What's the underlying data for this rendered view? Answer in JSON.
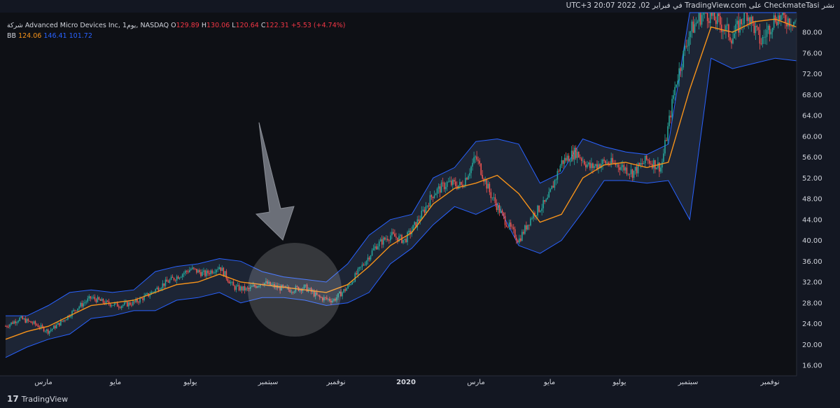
{
  "header": {
    "text": "نشر CheckmateTasi على TradingView.com في فبراير 02, 2022 20:07 UTC+3"
  },
  "legend": {
    "symbol": "شركة Advanced Micro Devices Inc, يوم1, NASDAQ",
    "o_label": "O",
    "o": "129.89",
    "h_label": "H",
    "h": "130.06",
    "l_label": "L",
    "l": "120.64",
    "c_label": "C",
    "c": "122.31",
    "change": "+5.53 (+4.74%)",
    "bb_label": "BB",
    "bb_mid": "124.06",
    "bb_up": "146.41",
    "bb_low": "101.72"
  },
  "footer": {
    "brand": "TradingView"
  },
  "chart_data": {
    "type": "candlestick",
    "y_axis_ticks": [
      "16.00",
      "20.00",
      "24.00",
      "28.00",
      "32.00",
      "36.00",
      "40.00",
      "44.00",
      "48.00",
      "52.00",
      "56.00",
      "60.00",
      "64.00",
      "68.00",
      "72.00",
      "76.00",
      "80.00"
    ],
    "ylim": [
      16,
      84
    ],
    "x_axis_ticks": [
      "مارس",
      "مايو",
      "يوليو",
      "سبتمبر",
      "نوفمبر",
      "2020",
      "مارس",
      "مايو",
      "يوليو",
      "سبتمبر",
      "نوفمبر"
    ],
    "series": [
      {
        "name": "BB",
        "points": [
          {
            "x": 0,
            "mid": 21.0,
            "up": 25.5,
            "low": 17.5
          },
          {
            "x": 3,
            "mid": 22.5,
            "up": 25.5,
            "low": 19.5
          },
          {
            "x": 6,
            "mid": 23.5,
            "up": 27.5,
            "low": 21.0
          },
          {
            "x": 9,
            "mid": 25.5,
            "up": 30.0,
            "low": 22.0
          },
          {
            "x": 12,
            "mid": 27.5,
            "up": 30.5,
            "low": 25.0
          },
          {
            "x": 15,
            "mid": 28.0,
            "up": 30.0,
            "low": 25.5
          },
          {
            "x": 18,
            "mid": 28.5,
            "up": 30.5,
            "low": 26.5
          },
          {
            "x": 21,
            "mid": 30.0,
            "up": 34.0,
            "low": 26.5
          },
          {
            "x": 24,
            "mid": 31.5,
            "up": 35.0,
            "low": 28.5
          },
          {
            "x": 27,
            "mid": 32.0,
            "up": 35.5,
            "low": 29.0
          },
          {
            "x": 30,
            "mid": 33.5,
            "up": 36.5,
            "low": 30.0
          },
          {
            "x": 33,
            "mid": 32.0,
            "up": 36.0,
            "low": 28.0
          },
          {
            "x": 36,
            "mid": 31.5,
            "up": 34.0,
            "low": 29.0
          },
          {
            "x": 39,
            "mid": 31.0,
            "up": 33.0,
            "low": 29.0
          },
          {
            "x": 42,
            "mid": 30.5,
            "up": 32.5,
            "low": 28.5
          },
          {
            "x": 45,
            "mid": 30.0,
            "up": 32.0,
            "low": 27.5
          },
          {
            "x": 48,
            "mid": 31.5,
            "up": 35.5,
            "low": 28.0
          },
          {
            "x": 51,
            "mid": 35.0,
            "up": 41.0,
            "low": 30.0
          },
          {
            "x": 54,
            "mid": 39.0,
            "up": 44.0,
            "low": 35.5
          },
          {
            "x": 57,
            "mid": 41.5,
            "up": 45.0,
            "low": 38.5
          },
          {
            "x": 60,
            "mid": 47.0,
            "up": 52.0,
            "low": 43.0
          },
          {
            "x": 63,
            "mid": 50.0,
            "up": 54.0,
            "low": 46.5
          },
          {
            "x": 66,
            "mid": 51.0,
            "up": 59.0,
            "low": 45.0
          },
          {
            "x": 69,
            "mid": 52.5,
            "up": 59.5,
            "low": 47.0
          },
          {
            "x": 72,
            "mid": 49.0,
            "up": 58.5,
            "low": 39.0
          },
          {
            "x": 75,
            "mid": 43.5,
            "up": 51.0,
            "low": 37.5
          },
          {
            "x": 78,
            "mid": 45.0,
            "up": 53.0,
            "low": 40.0
          },
          {
            "x": 81,
            "mid": 52.0,
            "up": 59.5,
            "low": 45.5
          },
          {
            "x": 84,
            "mid": 54.5,
            "up": 58.0,
            "low": 51.5
          },
          {
            "x": 87,
            "mid": 55.0,
            "up": 57.0,
            "low": 51.5
          },
          {
            "x": 90,
            "mid": 54.0,
            "up": 56.5,
            "low": 51.0
          },
          {
            "x": 93,
            "mid": 55.0,
            "up": 58.5,
            "low": 51.5
          },
          {
            "x": 96,
            "mid": 69.0,
            "up": 84.0,
            "low": 44.0
          },
          {
            "x": 99,
            "mid": 81.0,
            "up": 86.0,
            "low": 75.0
          },
          {
            "x": 102,
            "mid": 80.0,
            "up": 86.0,
            "low": 73.0
          },
          {
            "x": 105,
            "mid": 82.0,
            "up": 86.0,
            "low": 74.0
          },
          {
            "x": 108,
            "mid": 82.5,
            "up": 86.0,
            "low": 75.0
          },
          {
            "x": 111,
            "mid": 81.0,
            "up": 86.0,
            "low": 74.5
          }
        ]
      }
    ],
    "price_path": [
      [
        0,
        23.5
      ],
      [
        2,
        25.0
      ],
      [
        4,
        24.0
      ],
      [
        6,
        22.5
      ],
      [
        8,
        24.5
      ],
      [
        10,
        27.0
      ],
      [
        12,
        29.0
      ],
      [
        14,
        28.0
      ],
      [
        16,
        27.5
      ],
      [
        18,
        28.0
      ],
      [
        20,
        29.5
      ],
      [
        22,
        31.5
      ],
      [
        24,
        33.0
      ],
      [
        26,
        34.5
      ],
      [
        28,
        33.5
      ],
      [
        30,
        35.0
      ],
      [
        32,
        31.0
      ],
      [
        34,
        30.5
      ],
      [
        36,
        32.0
      ],
      [
        38,
        31.0
      ],
      [
        40,
        30.5
      ],
      [
        42,
        31.0
      ],
      [
        44,
        29.0
      ],
      [
        46,
        28.5
      ],
      [
        48,
        31.0
      ],
      [
        50,
        35.0
      ],
      [
        52,
        39.0
      ],
      [
        54,
        41.0
      ],
      [
        56,
        40.0
      ],
      [
        58,
        44.0
      ],
      [
        60,
        49.0
      ],
      [
        62,
        51.0
      ],
      [
        64,
        50.5
      ],
      [
        66,
        56.0
      ],
      [
        68,
        49.0
      ],
      [
        70,
        44.0
      ],
      [
        72,
        40.0
      ],
      [
        74,
        45.0
      ],
      [
        76,
        47.5
      ],
      [
        78,
        55.0
      ],
      [
        80,
        57.0
      ],
      [
        82,
        54.0
      ],
      [
        84,
        55.0
      ],
      [
        86,
        54.5
      ],
      [
        88,
        53.0
      ],
      [
        90,
        55.5
      ],
      [
        92,
        54.0
      ],
      [
        94,
        70.0
      ],
      [
        96,
        80.0
      ],
      [
        98,
        84.0
      ],
      [
        100,
        82.0
      ],
      [
        102,
        79.0
      ],
      [
        104,
        84.0
      ],
      [
        106,
        78.0
      ],
      [
        108,
        83.0
      ],
      [
        111,
        82.0
      ]
    ],
    "annotations": [
      {
        "type": "arrow",
        "label": ""
      },
      {
        "type": "circle-highlight",
        "label": ""
      }
    ]
  }
}
